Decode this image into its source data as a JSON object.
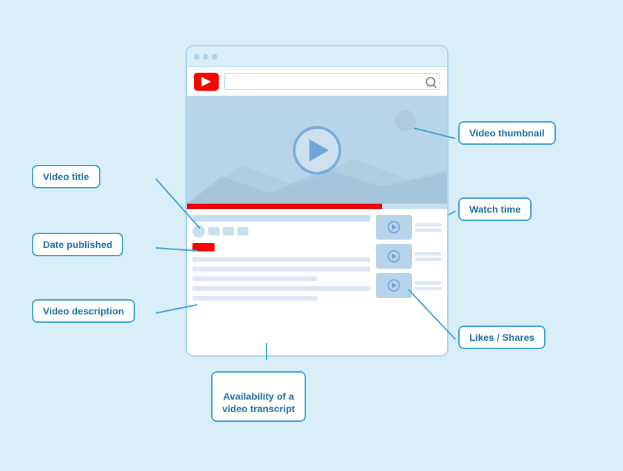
{
  "background_color": "#daeef8",
  "labels": {
    "video_title": "Video title",
    "date_published": "Date published",
    "video_description": "Video description",
    "availability_transcript": "Availability of a\nvideo transcript",
    "video_thumbnail": "Video thumbnail",
    "watch_time": "Watch time",
    "likes_shares": "Likes / Shares"
  },
  "browser": {
    "dots": [
      "dot1",
      "dot2",
      "dot3"
    ]
  }
}
